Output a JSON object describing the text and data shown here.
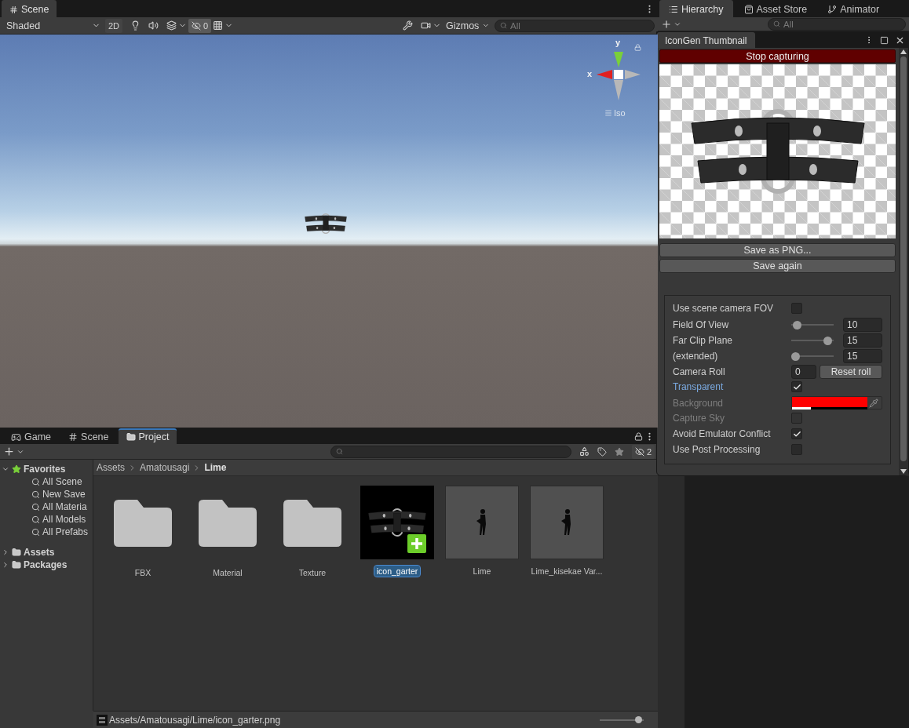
{
  "scene": {
    "tab": {
      "label": "Scene",
      "selected": true
    },
    "toolbar": {
      "shading": "Shaded",
      "mode_2d": "2D",
      "hidden_count": "0",
      "gizmos": "Gizmos",
      "search": {
        "placeholder": "All"
      }
    },
    "gizmo": {
      "y_label": "y",
      "x_label": "x",
      "projection": "Iso"
    }
  },
  "right_tabs": [
    {
      "label": "Hierarchy",
      "selected": true
    },
    {
      "label": "Asset Store",
      "selected": false
    },
    {
      "label": "Animator",
      "selected": false
    }
  ],
  "hierarchy_search": {
    "placeholder": "All"
  },
  "icongen": {
    "title": "IconGen Thumbnail",
    "stop_button": "Stop capturing",
    "buttons": [
      "Save as PNG...",
      "Save again"
    ],
    "settings": [
      {
        "kind": "checkbox",
        "label": "Use scene camera FOV",
        "checked": false,
        "disabled": false,
        "highlighted": false
      },
      {
        "kind": "slider",
        "label": "Field Of View",
        "level": 0.05,
        "value": "10",
        "disabled": false,
        "highlighted": false
      },
      {
        "kind": "slider",
        "label": "Far Clip Plane",
        "level": 0.95,
        "value": "15",
        "disabled": false,
        "highlighted": false
      },
      {
        "kind": "slider",
        "label": "(extended)",
        "level": 0.0,
        "value": "15",
        "disabled": false,
        "highlighted": false
      },
      {
        "kind": "number",
        "label": "Camera Roll",
        "value": "0",
        "button": "Reset roll",
        "disabled": false,
        "highlighted": false
      },
      {
        "kind": "checkbox",
        "label": "Transparent",
        "checked": true,
        "disabled": false,
        "highlighted": true
      },
      {
        "kind": "color",
        "label": "Background",
        "color": "#ff0000",
        "level": 0.25,
        "disabled": true,
        "highlighted": false
      },
      {
        "kind": "checkbox",
        "label": "Capture Sky",
        "checked": false,
        "disabled": true,
        "highlighted": false
      },
      {
        "kind": "checkbox",
        "label": "Avoid Emulator Conflict",
        "checked": true,
        "disabled": false,
        "highlighted": false
      },
      {
        "kind": "checkbox",
        "label": "Use Post Processing",
        "checked": false,
        "disabled": false,
        "highlighted": false
      }
    ]
  },
  "project": {
    "tabs": [
      {
        "kind": "game",
        "label": "Game",
        "selected": false
      },
      {
        "kind": "scene",
        "label": "Scene",
        "selected": false
      },
      {
        "kind": "project",
        "label": "Project",
        "selected": true
      }
    ],
    "hidden_count": "2",
    "tree": [
      {
        "kind": "favorites",
        "label": "Favorites",
        "expanded": true,
        "children": [
          {
            "label": "All Scene"
          },
          {
            "label": "New Save"
          },
          {
            "label": "All Materia"
          },
          {
            "label": "All Models"
          },
          {
            "label": "All Prefabs"
          }
        ]
      },
      {
        "kind": "folder",
        "label": "Assets",
        "expanded": false
      },
      {
        "kind": "folder",
        "label": "Packages",
        "expanded": false
      }
    ],
    "breadcrumb": [
      "Assets",
      "Amatousagi",
      "Lime"
    ],
    "items": [
      {
        "kind": "folder",
        "label": "FBX",
        "selected": false
      },
      {
        "kind": "folder",
        "label": "Material",
        "selected": false
      },
      {
        "kind": "folder",
        "label": "Texture",
        "selected": false
      },
      {
        "kind": "texture",
        "label": "icon_garter",
        "selected": true
      },
      {
        "kind": "prefab",
        "label": "Lime",
        "selected": false
      },
      {
        "kind": "prefab",
        "label": "Lime_kisekae Var...",
        "selected": false
      }
    ],
    "status_path": "Assets/Amatousagi/Lime/icon_garter.png",
    "zoom": {
      "level": 0.95
    }
  }
}
